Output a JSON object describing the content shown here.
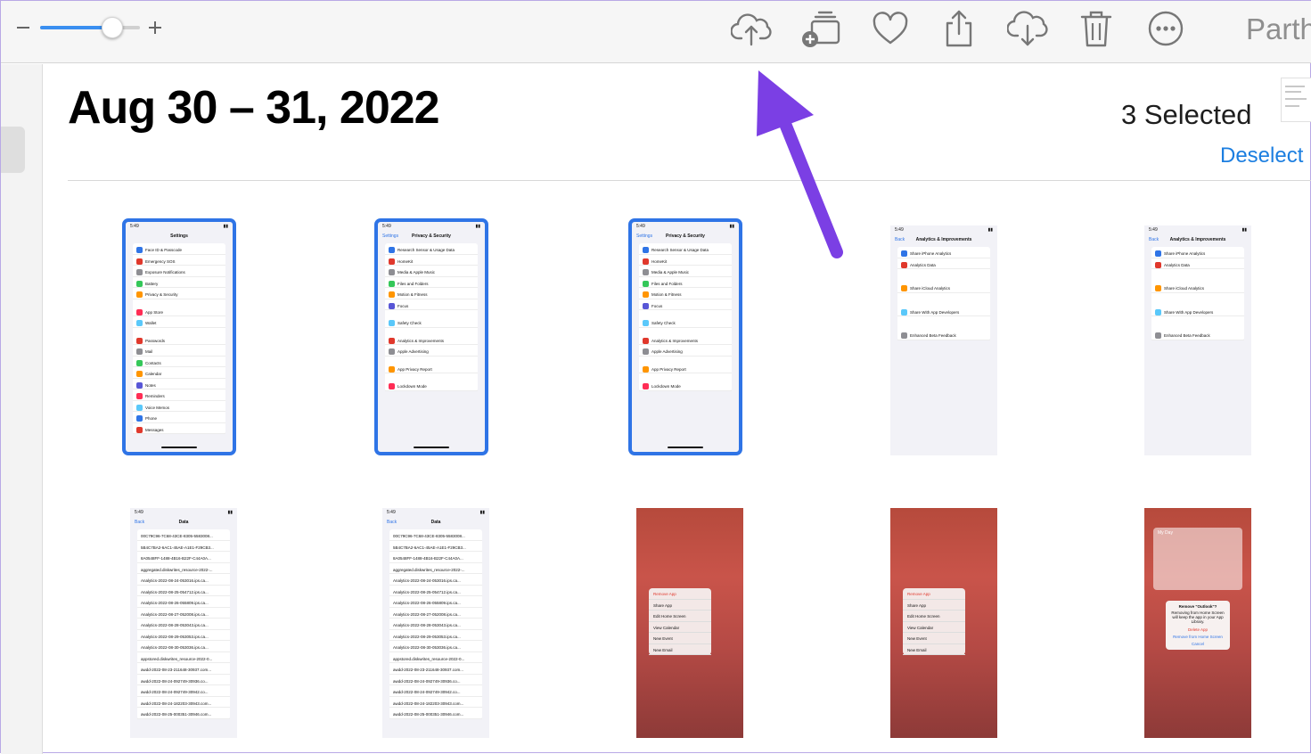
{
  "toolbar": {
    "zoom_level": 0.72,
    "share_label": "Parth",
    "icons": [
      "upload-cloud-icon",
      "add-to-album-icon",
      "heart-icon",
      "share-icon",
      "download-cloud-icon",
      "trash-icon",
      "more-icon"
    ]
  },
  "header": {
    "date_range": "Aug 30 – 31, 2022",
    "selected_count": "3 Selected",
    "deselect_label": "Deselect"
  },
  "colors": {
    "accent": "#1b7ee0",
    "selection": "#2f74e6",
    "arrow": "#7b3fe4"
  },
  "photos": {
    "row1": [
      {
        "nav": "Settings",
        "selected": true,
        "items": [
          "Face ID & Passcode",
          "Emergency SOS",
          "Exposure Notifications",
          "Battery",
          "Privacy & Security",
          "",
          "App Store",
          "Wallet",
          "",
          "Passwords",
          "Mail",
          "Contacts",
          "Calendar",
          "Notes",
          "Reminders",
          "Voice Memos",
          "Phone",
          "Messages"
        ]
      },
      {
        "back": "Settings",
        "nav": "Privacy & Security",
        "selected": true,
        "items": [
          "Research Sensor & Usage Data",
          "HomeKit",
          "Media & Apple Music",
          "Files and Folders",
          "Motion & Fitness",
          "Focus",
          "",
          "Safety Check",
          "",
          "Analytics & Improvements",
          "Apple Advertising",
          "",
          "App Privacy Report",
          "",
          "Lockdown Mode"
        ]
      },
      {
        "back": "Settings",
        "nav": "Privacy & Security",
        "selected": true,
        "items": [
          "Research Sensor & Usage Data",
          "HomeKit",
          "Media & Apple Music",
          "Files and Folders",
          "Motion & Fitness",
          "Focus",
          "",
          "Safety Check",
          "",
          "Analytics & Improvements",
          "Apple Advertising",
          "",
          "App Privacy Report",
          "",
          "Lockdown Mode"
        ]
      },
      {
        "back": "Back",
        "nav": "Analytics & Improvements",
        "selected": false,
        "items": [
          "Share iPhone Analytics",
          "Analytics Data",
          "",
          "",
          "Share iCloud Analytics",
          "",
          "",
          "Share With App Developers",
          "",
          "",
          "Enhanced Beta Feedback"
        ]
      },
      {
        "back": "Back",
        "nav": "Analytics & Improvements",
        "selected": false,
        "items": [
          "Share iPhone Analytics",
          "Analytics Data",
          "",
          "",
          "Share iCloud Analytics",
          "",
          "",
          "Share With App Developers",
          "",
          "",
          "Enhanced Beta Feedback"
        ]
      }
    ],
    "row2": [
      {
        "back": "Back",
        "nav": "Data",
        "items": [
          "00C79C96-7C68-43CE-8305-5583008...",
          "5B4C7BA2-6AC1-45AE-A1E1-F29CB3...",
          "8A0548FF-1488-4B16-B22F-C44A0A...",
          "aggregated.diskwrites_resource-2022-...",
          "Analytics-2022-08-24-053016.ips.ca...",
          "Analytics-2022-08-25-054712.ips.ca...",
          "Analytics-2022-08-26-055809.ips.ca...",
          "Analytics-2022-08-27-052008.ips.ca...",
          "Analytics-2022-08-28-053043.ips.ca...",
          "Analytics-2022-08-29-053053.ips.ca...",
          "Analytics-2022-08-30-053036.ips.ca...",
          "appstored.diskwrites_resource-2022-0...",
          "awdd-2022-08-23-211648-30937.com...",
          "awdd-2022-08-24-092749-30936.co...",
          "awdd-2022-08-24-092749-30942.co...",
          "awdd-2022-08-24-182203-30943.com...",
          "awdd-2022-08-25-000351-30946.com..."
        ]
      },
      {
        "back": "Back",
        "nav": "Data",
        "items": [
          "00C79C96-7C68-43CE-8305-5583008...",
          "5B4C7BA2-6AC1-45AE-A1E1-F29CB3...",
          "8A0548FF-1488-4B16-B22F-C44A0A...",
          "aggregated.diskwrites_resource-2022-...",
          "Analytics-2022-08-24-053016.ips.ca...",
          "Analytics-2022-08-25-054712.ips.ca...",
          "Analytics-2022-08-26-055809.ips.ca...",
          "Analytics-2022-08-27-052008.ips.ca...",
          "Analytics-2022-08-28-053043.ips.ca...",
          "Analytics-2022-08-29-053053.ips.ca...",
          "Analytics-2022-08-30-053036.ips.ca...",
          "appstored.diskwrites_resource-2022-0...",
          "awdd-2022-08-23-211648-30937.com...",
          "awdd-2022-08-24-092749-30936.co...",
          "awdd-2022-08-24-092749-30942.co...",
          "awdd-2022-08-24-182203-30943.com...",
          "awdd-2022-08-25-000351-30946.com..."
        ]
      },
      {
        "menu": [
          "Remove App",
          "Share App",
          "Edit Home Screen",
          "View Calendar",
          "New Event",
          "New Email"
        ]
      },
      {
        "menu": [
          "Remove App",
          "Share App",
          "Edit Home Screen",
          "View Calendar",
          "New Event",
          "New Email"
        ]
      },
      {
        "header": "My Day",
        "alert_title": "Remove \"Outlook\"?",
        "alert_body": "Removing from Home Screen will keep the app in your App Library.",
        "alert_buttons": [
          "Delete App",
          "Remove from Home Screen",
          "Cancel"
        ]
      }
    ]
  }
}
